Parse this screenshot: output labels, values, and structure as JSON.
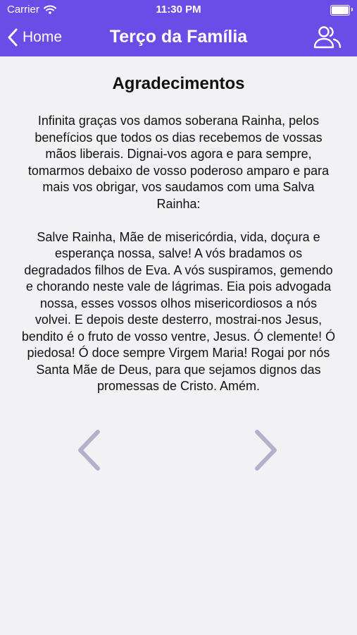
{
  "status_bar": {
    "carrier": "Carrier",
    "time": "11:30 PM",
    "battery_level": 1.0
  },
  "nav": {
    "back_label": "Home",
    "title": "Terço da Família",
    "users_icon": "users-icon"
  },
  "section": {
    "heading": "Agradecimentos",
    "paragraphs": [
      "Infinita graças vos damos soberana Rainha, pelos benefícios que todos os dias recebemos de vossas mãos liberais. Dignai-vos agora e para sempre, tomarmos debaixo de vosso poderoso amparo e para mais vos obrigar, vos saudamos com uma Salva Rainha:",
      "Salve Rainha, Mãe de misericórdia, vida, doçura e esperança nossa, salve! A vós bradamos os degradados filhos de Eva. A vós suspiramos, gemendo e chorando neste vale de lágrimas. Eia pois advogada nossa, esses vossos olhos misericordiosos a nós volvei. E depois deste desterro, mostrai-nos Jesus, bendito é o fruto de vosso ventre, Jesus. Ó clemente! Ó piedosa! Ó doce sempre Virgem Maria! Rogai por nós Santa Mãe de Deus, para que sejamos dignos das promessas de Cristo. Amém."
    ]
  },
  "pager": {
    "prev_icon": "chevron-left-icon",
    "next_icon": "chevron-right-icon"
  },
  "colors": {
    "accent": "#6a4de6",
    "background": "#f2f2f4",
    "arrow": "#b3b0cc"
  }
}
